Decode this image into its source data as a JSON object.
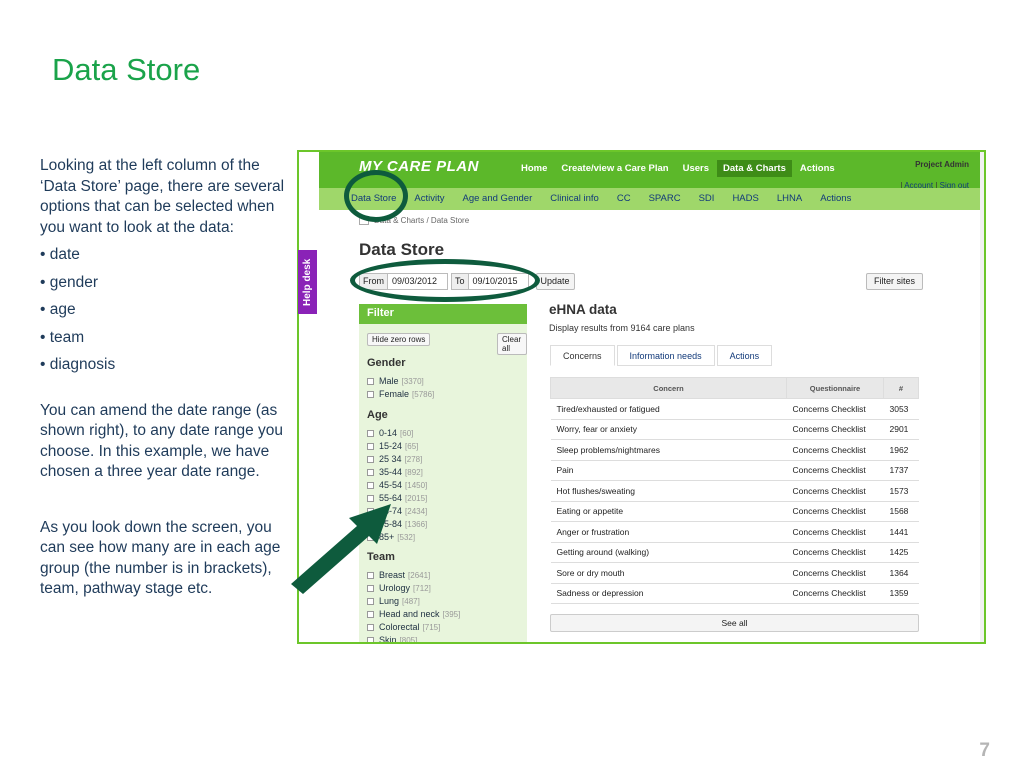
{
  "slide": {
    "title": "Data Store",
    "intro": "Looking at the left column of the ‘Data Store’ page, there are several options that can be selected when you want to look at the data:",
    "bullets": [
      "• date",
      "• gender",
      "• age",
      "• team",
      "• diagnosis"
    ],
    "para2": "You can amend the date range (as shown right), to any date range you choose. In this example, we have chosen a three year date range.",
    "para3": "As you look down the screen, you can see how many are in each age group (the number is in brackets), team, pathway stage etc.",
    "page_number": "7"
  },
  "app": {
    "logo": "MY CARE PLAN",
    "help_desk": "Help desk",
    "top_nav": [
      "Home",
      "Create/view a Care Plan",
      "Users",
      "Data & Charts",
      "Actions"
    ],
    "top_nav_active": "Data & Charts",
    "admin": {
      "role": "Project Admin",
      "account": "Account",
      "sep": "|",
      "signout": "Sign out"
    },
    "sub_nav": [
      "Data Store",
      "Activity",
      "Age and Gender",
      "Clinical info",
      "CC",
      "SPARC",
      "SDI",
      "HADS",
      "LHNA",
      "Actions"
    ],
    "breadcrumb": "Data & Charts / Data Store",
    "page_title": "Data Store",
    "date": {
      "from_label": "From",
      "from_value": "09/03/2012",
      "to_label": "To",
      "to_value": "09/10/2015",
      "update_label": "Update"
    },
    "filter_sites_label": "Filter sites",
    "filter": {
      "title": "Filter",
      "hide_zero_label": "Hide zero rows",
      "clear_all_label": "Clear all",
      "gender_title": "Gender",
      "gender": [
        {
          "label": "Male",
          "count": "[3370]"
        },
        {
          "label": "Female",
          "count": "[5786]"
        }
      ],
      "age_title": "Age",
      "age": [
        {
          "label": "0-14",
          "count": "[60]"
        },
        {
          "label": "15-24",
          "count": "[65]"
        },
        {
          "label": "25 34",
          "count": "[278]"
        },
        {
          "label": "35-44",
          "count": "[892]"
        },
        {
          "label": "45-54",
          "count": "[1450]"
        },
        {
          "label": "55-64",
          "count": "[2015]"
        },
        {
          "label": "65-74",
          "count": "[2434]"
        },
        {
          "label": "75-84",
          "count": "[1366]"
        },
        {
          "label": "85+",
          "count": "[532]"
        }
      ],
      "team_title": "Team",
      "team": [
        {
          "label": "Breast",
          "count": "[2641]"
        },
        {
          "label": "Urology",
          "count": "[712]"
        },
        {
          "label": "Lung",
          "count": "[487]"
        },
        {
          "label": "Head and neck",
          "count": "[395]"
        },
        {
          "label": "Colorectal",
          "count": "[715]"
        },
        {
          "label": "Skin",
          "count": "[805]"
        }
      ]
    },
    "ehna": {
      "title": "eHNA data",
      "subtitle": "Display results from 9164 care plans",
      "tabs": [
        "Concerns",
        "Information needs",
        "Actions"
      ],
      "active_tab": "Concerns",
      "columns": [
        "Concern",
        "Questionnaire",
        "#"
      ],
      "rows": [
        [
          "Tired/exhausted or fatigued",
          "Concerns Checklist",
          "3053"
        ],
        [
          "Worry, fear or anxiety",
          "Concerns Checklist",
          "2901"
        ],
        [
          "Sleep problems/nightmares",
          "Concerns Checklist",
          "1962"
        ],
        [
          "Pain",
          "Concerns Checklist",
          "1737"
        ],
        [
          "Hot flushes/sweating",
          "Concerns Checklist",
          "1573"
        ],
        [
          "Eating or appetite",
          "Concerns Checklist",
          "1568"
        ],
        [
          "Anger or frustration",
          "Concerns Checklist",
          "1441"
        ],
        [
          "Getting around (walking)",
          "Concerns Checklist",
          "1425"
        ],
        [
          "Sore or dry mouth",
          "Concerns Checklist",
          "1364"
        ],
        [
          "Sadness or depression",
          "Concerns Checklist",
          "1359"
        ]
      ],
      "see_all_label": "See all"
    }
  },
  "colors": {
    "title_green": "#1aa34a",
    "nav_green": "#5cb82a",
    "annotation": "#0e5b3d",
    "helpdesk": "#8a22b7"
  }
}
